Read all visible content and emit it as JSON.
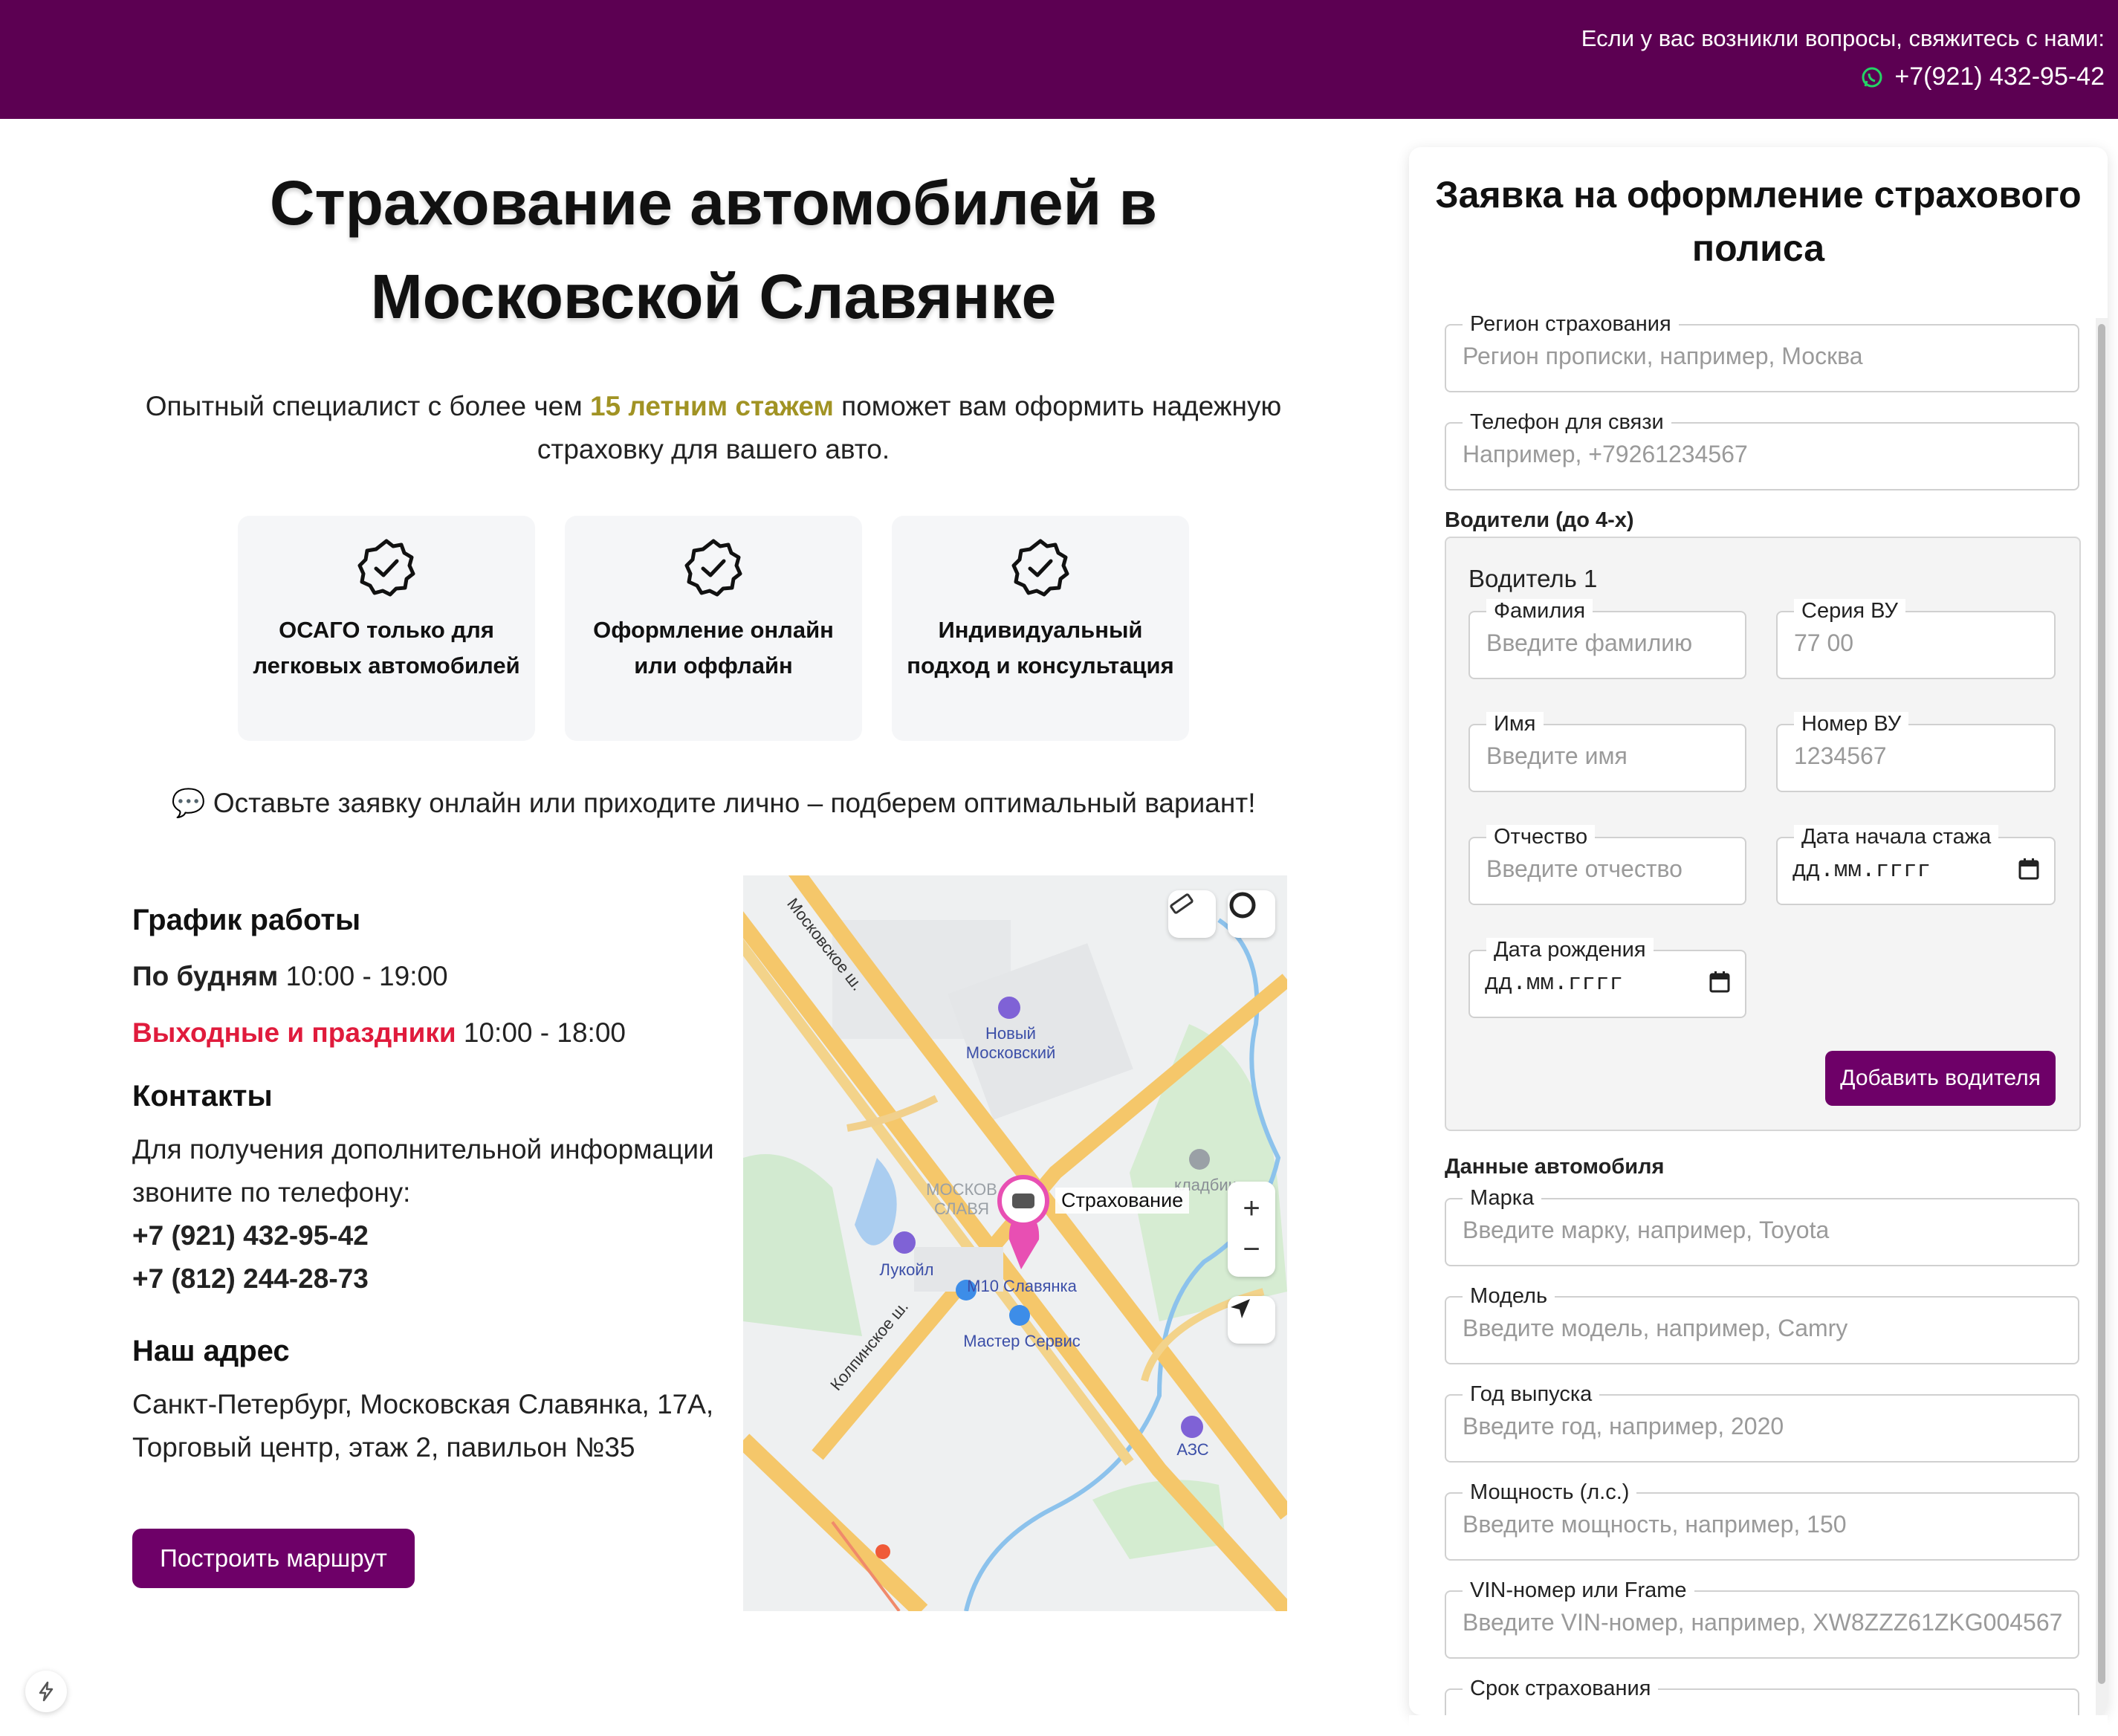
{
  "topbar": {
    "question": "Если у вас возникли вопросы, свяжитесь с нами:",
    "phone": "+7(921) 432-95-42",
    "bg": "#5c0052"
  },
  "hero": {
    "title": "Страхование автомобилей в Московской Славянке",
    "lead_before": "Опытный специалист с более чем ",
    "lead_highlight": "15 летним стажем",
    "lead_after": " поможет вам оформить надежную страховку для вашего авто."
  },
  "features": [
    {
      "icon": "badge-check-icon",
      "text": "ОСАГО только для легковых автомобилей"
    },
    {
      "icon": "badge-check-icon",
      "text": "Оформление онлайн или оффлайн"
    },
    {
      "icon": "badge-check-icon",
      "text": "Индивидуальный подход и консультация"
    }
  ],
  "callout": "💬 Оставьте заявку онлайн или приходите лично – подберем оптимальный вариант!",
  "schedule": {
    "heading": "График работы",
    "weekdays_label": "По будням",
    "weekdays_hours": "10:00 - 19:00",
    "weekend_label": "Выходные и праздники",
    "weekend_hours": "10:00 - 18:00"
  },
  "contacts": {
    "heading": "Контакты",
    "text": "Для получения дополнительной информации звоните по телефону:",
    "phone1": "+7 (921) 432-95-42",
    "phone2": "+7 (812) 244-28-73"
  },
  "address": {
    "heading": "Наш адрес",
    "text": "Санкт-Петербург, Московская Славянка, 17А, Торговый центр, этаж 2, павильон №35"
  },
  "route_button": "Построить маршрут",
  "map": {
    "pin_label": "Страхование",
    "labels": {
      "novy": "Новый Московский",
      "lukoil": "Лукойл",
      "m10": "М10 Славянка",
      "master": "Мастер Сервис",
      "azs": "АЗС",
      "cemetery": "кладбище",
      "moskov": "МОСКОВ СЛАВЯ",
      "road1": "Московское ш.",
      "road2": "Колпинское ш."
    },
    "zoom_in": "+",
    "zoom_out": "−"
  },
  "form": {
    "title": "Заявка на оформление страхового полиса",
    "region": {
      "label": "Регион страхования",
      "placeholder": "Регион прописки, например, Москва"
    },
    "phone": {
      "label": "Телефон для связи",
      "placeholder": "Например, +79261234567"
    },
    "drivers_label": "Водители (до 4-х)",
    "driver": {
      "title": "Водитель 1",
      "surname": {
        "label": "Фамилия",
        "placeholder": "Введите фамилию"
      },
      "series": {
        "label": "Серия ВУ",
        "placeholder": "77 00"
      },
      "name": {
        "label": "Имя",
        "placeholder": "Введите имя"
      },
      "number": {
        "label": "Номер ВУ",
        "placeholder": "1234567"
      },
      "patronymic": {
        "label": "Отчество",
        "placeholder": "Введите отчество"
      },
      "exp_start": {
        "label": "Дата начала стажа",
        "value": "дд.мм.гггг"
      },
      "birth": {
        "label": "Дата рождения",
        "value": "дд.мм.гггг"
      }
    },
    "add_driver": "Добавить водителя",
    "car_label": "Данные автомобиля",
    "brand": {
      "label": "Марка",
      "placeholder": "Введите марку, например, Toyota"
    },
    "model": {
      "label": "Модель",
      "placeholder": "Введите модель, например, Camry"
    },
    "year": {
      "label": "Год выпуска",
      "placeholder": "Введите год, например, 2020"
    },
    "power": {
      "label": "Мощность (л.с.)",
      "placeholder": "Введите мощность, например, 150"
    },
    "vin": {
      "label": "VIN-номер или Frame",
      "placeholder": "Введите VIN-номер, например, XW8ZZZ61ZKG004567"
    },
    "term": {
      "label": "Срок страхования"
    }
  }
}
